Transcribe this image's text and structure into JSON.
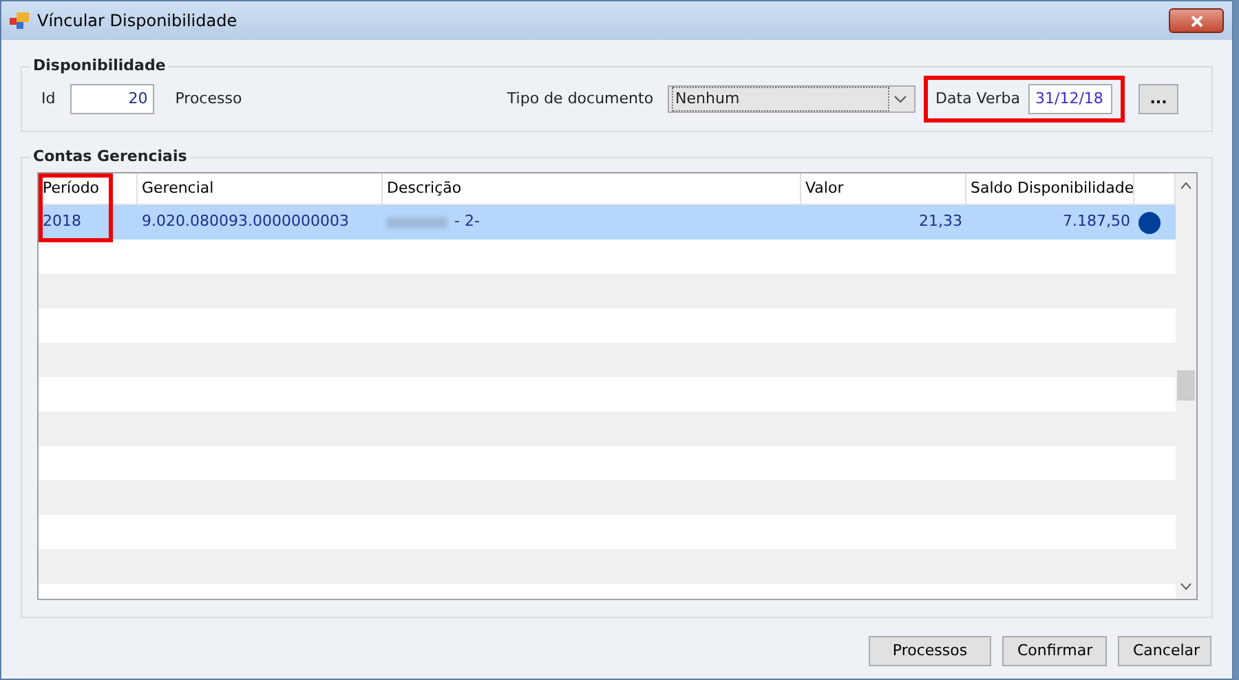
{
  "window": {
    "title": "Víncular Disponibilidade"
  },
  "disponibilidade": {
    "title": "Disponibilidade",
    "id_label": "Id",
    "id_value": "20",
    "processo_label": "Processo",
    "tipo_label": "Tipo de documento",
    "tipo_value": "Nenhum",
    "data_label": "Data Verba",
    "data_value": "31/12/18",
    "more_button": "...",
    "data_highlighted": true
  },
  "contas": {
    "title": "Contas Gerenciais",
    "columns": [
      "Período",
      "Gerencial",
      "Descrição",
      "Valor",
      "Saldo Disponibilidade"
    ],
    "periodo_highlighted": true,
    "rows": [
      {
        "periodo": "2018",
        "gerencial": "9.020.080093.0000000003",
        "descricao": "- 2-",
        "descricao_redacted": true,
        "valor": "21,33",
        "saldo": "7.187,50",
        "selected": true,
        "color": "#003f9a"
      }
    ]
  },
  "buttons": [
    "Processos",
    "Confirmar",
    "Cancelar"
  ]
}
